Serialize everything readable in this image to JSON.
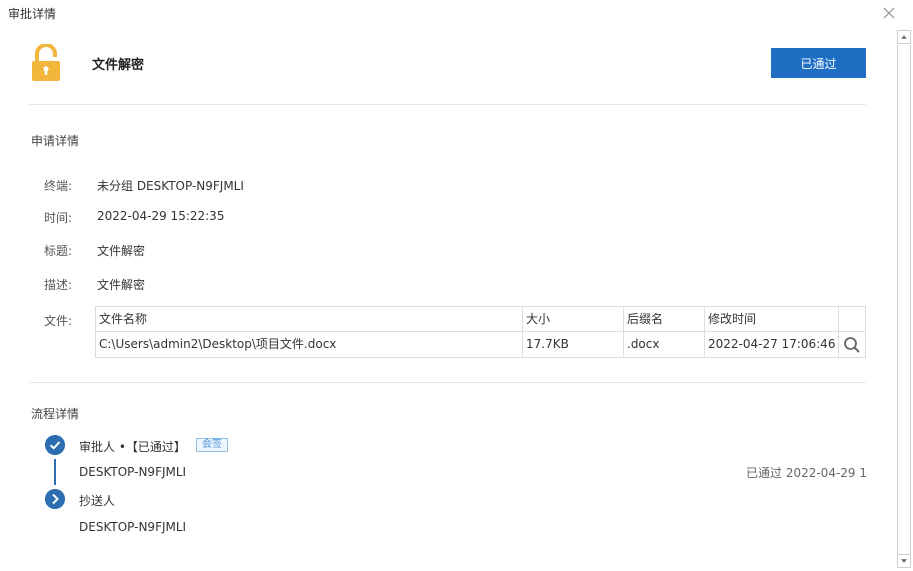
{
  "window": {
    "title": "审批详情"
  },
  "header": {
    "request_title": "文件解密",
    "status_label": "已通过"
  },
  "application": {
    "section_title": "申请详情",
    "fields": [
      {
        "label": "终端:",
        "value": "未分组 DESKTOP-N9FJMLI"
      },
      {
        "label": "时间:",
        "value": "2022-04-29 15:22:35"
      },
      {
        "label": "标题:",
        "value": "文件解密"
      },
      {
        "label": "描述:",
        "value": "文件解密"
      }
    ],
    "files_label": "文件:",
    "files_table": {
      "columns": [
        "文件名称",
        "大小",
        "后缀名",
        "修改时间"
      ],
      "rows": [
        [
          "C:\\Users\\admin2\\Desktop\\项目文件.docx",
          "17.7KB",
          ".docx",
          "2022-04-27 17:06:46"
        ]
      ]
    }
  },
  "process": {
    "section_title": "流程详情",
    "steps": [
      {
        "title": "审批人 •【已通过】",
        "tag": "会签",
        "person": "DESKTOP-N9FJMLI",
        "status": "已通过 2022-04-29 1"
      },
      {
        "title": "抄送人",
        "person": "DESKTOP-N9FJMLI"
      }
    ]
  },
  "colors": {
    "accent": "#1e6fc4",
    "node": "#2d6db1",
    "lock": "#f2b63c",
    "tag": "#4a94d6"
  },
  "icons": {
    "lock": "lock-open-icon",
    "close": "close-icon",
    "search": "search-icon",
    "check": "check-circle-icon",
    "arrow": "chevron-right-circle-icon"
  }
}
